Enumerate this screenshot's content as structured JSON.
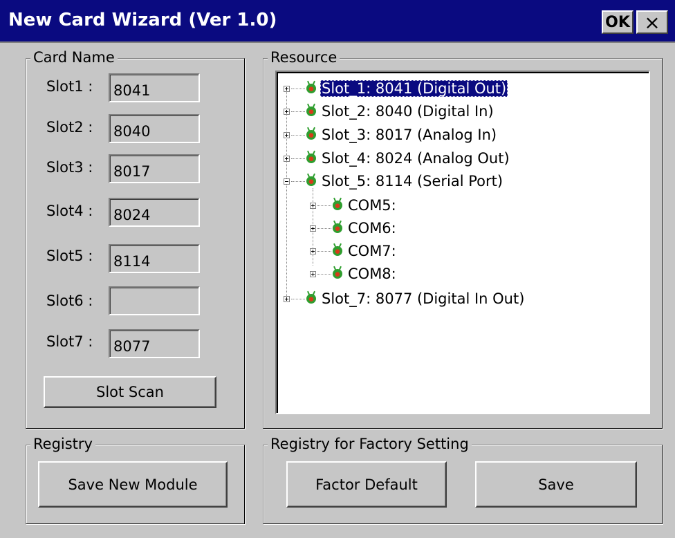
{
  "window": {
    "title": "New Card Wizard (Ver 1.0)",
    "ok_label": "OK",
    "close_label": "×"
  },
  "card_name": {
    "group_label": "Card Name",
    "slots": [
      {
        "label": "Slot1 :",
        "value": "8041"
      },
      {
        "label": "Slot2 :",
        "value": "8040"
      },
      {
        "label": "Slot3 :",
        "value": "8017"
      },
      {
        "label": "Slot4 :",
        "value": "8024"
      },
      {
        "label": "Slot5 :",
        "value": "8114"
      },
      {
        "label": "Slot6 :",
        "value": ""
      },
      {
        "label": "Slot7 :",
        "value": "8077"
      }
    ],
    "scan_button": "Slot Scan"
  },
  "resource": {
    "group_label": "Resource",
    "tree": [
      {
        "label": "Slot_1: 8041 (Digital Out)",
        "expander": "plus",
        "selected": true
      },
      {
        "label": "Slot_2: 8040 (Digital In)",
        "expander": "plus"
      },
      {
        "label": "Slot_3: 8017 (Analog In)",
        "expander": "plus"
      },
      {
        "label": "Slot_4: 8024 (Analog Out)",
        "expander": "plus"
      },
      {
        "label": "Slot_5: 8114 (Serial Port)",
        "expander": "minus"
      },
      {
        "label": "COM5:",
        "expander": "plus",
        "child": true
      },
      {
        "label": "COM6:",
        "expander": "plus",
        "child": true
      },
      {
        "label": "COM7:",
        "expander": "plus",
        "child": true
      },
      {
        "label": "COM8:",
        "expander": "plus",
        "child": true
      },
      {
        "label": "Slot_7: 8077 (Digital In Out)",
        "expander": "plus"
      }
    ]
  },
  "registry": {
    "group_label": "Registry",
    "save_new_module_button": "Save New Module"
  },
  "factory": {
    "group_label": "Registry for Factory Setting",
    "factor_default_button": "Factor Default",
    "save_button": "Save"
  },
  "colors": {
    "titlebar": "#0a0a80",
    "window_bg": "#c6c6c6",
    "selection": "#0a0a80",
    "node_icon_green": "#2f9e2f",
    "node_icon_red": "#d83a1a"
  }
}
